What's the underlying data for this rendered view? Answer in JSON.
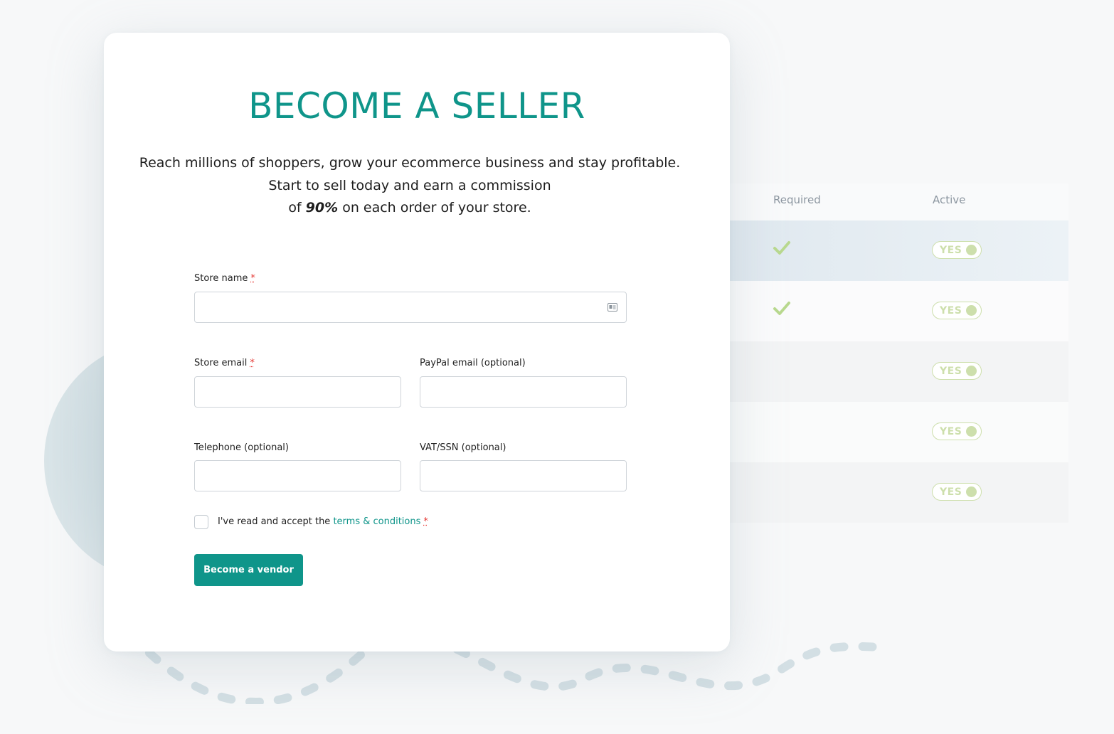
{
  "background_table": {
    "columns": [
      "Required",
      "Active"
    ],
    "rows": [
      {
        "required": true,
        "active": "YES"
      },
      {
        "required": true,
        "active": "YES"
      },
      {
        "required": false,
        "active": "YES"
      },
      {
        "required": false,
        "active": "YES"
      },
      {
        "required": false,
        "active": "YES"
      }
    ]
  },
  "form": {
    "title": "BECOME A SELLER",
    "subtitle_line1": "Reach millions of shoppers, grow your ecommerce business and stay profitable.",
    "subtitle_line2": "Start to sell today and earn a commission",
    "subtitle_line3_prefix": "of ",
    "subtitle_highlight": "90%",
    "subtitle_line3_suffix": " on each order of your store.",
    "required_marker": "*",
    "fields": {
      "store_name": {
        "label": "Store name",
        "value": ""
      },
      "store_email": {
        "label": "Store email",
        "value": ""
      },
      "paypal_email": {
        "label": "PayPal email (optional)",
        "value": ""
      },
      "telephone": {
        "label": "Telephone (optional)",
        "value": ""
      },
      "vat_ssn": {
        "label": "VAT/SSN (optional)",
        "value": ""
      }
    },
    "terms_prefix": "I've read and accept the ",
    "terms_link": "terms & conditions",
    "terms_checked": false,
    "submit_label": "Become a vendor"
  },
  "colors": {
    "accent": "#0f958a",
    "toggle": "#cddfac",
    "check": "#b9d98f",
    "required": "#e53935"
  },
  "icons": [
    "contact-card-icon",
    "checkmark-icon"
  ]
}
